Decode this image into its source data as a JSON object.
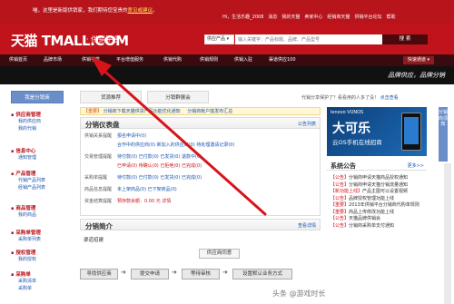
{
  "topbar": {
    "notice_prefix": "喵，这里是新版供销家，我们期待您宝贵的",
    "notice_link": "意见或建议",
    "notice_suffix": "。",
    "links": [
      "Hi，生活乐趣_2008",
      "消息",
      "我的天猫",
      "卖家中心",
      "经销商天猫",
      "供销平台论坛",
      "帮助"
    ]
  },
  "header": {
    "logo": "天猫 TMALL.COM",
    "logo_sub": "· 供销平台",
    "search_type": "供应产品 ▾",
    "search_placeholder": "输入关键字：产品标题、品牌、产品型号",
    "search_button": "搜 索"
  },
  "nav": {
    "items": [
      "供销首页",
      "品牌市场",
      "供销学堂",
      "平台增值服务",
      "供销代购",
      "供销规则",
      "供销入驻",
      "渠道供应100"
    ],
    "user_menu": "快速通道 ▾"
  },
  "slogan": "品牌供应，品牌分销",
  "tabs": {
    "items": [
      "我是分销商",
      "货源推荐",
      "分销群展会"
    ],
    "right_text": "代销分享保护了？看看用的人多了没！",
    "right_link": "点击查看"
  },
  "sidebar": [
    {
      "title": "供应商管理",
      "links": [
        "我的供应商",
        "我的代销"
      ]
    },
    {
      "title": "信息中心",
      "links": [
        "通知管理"
      ]
    },
    {
      "title": "产品管理",
      "links": [
        "代销产品列表",
        "经销产品列表"
      ]
    },
    {
      "title": "商品管理",
      "links": [
        "我的商品"
      ]
    },
    {
      "title": "采购单管理",
      "links": [
        "采购单列表"
      ]
    },
    {
      "title": "授权管理",
      "links": [
        "我的授权"
      ]
    },
    {
      "title": "采购单",
      "links": [
        "采购清单",
        "采购单"
      ]
    }
  ],
  "notice": {
    "tag1": "【重要】",
    "text1": "分销商下载天猫供货产品功能优化通知",
    "text2": "分销商帐户能发布汇总"
  },
  "dashboard": {
    "title": "分销仪表盘",
    "more": "公告列表",
    "rows": [
      {
        "label": "供销关系提醒",
        "text": "报名申请中(0)"
      },
      {
        "label": "",
        "text": "合作中的供应商(0)   新加入的供应商(0)   待处理邀请记录(0)"
      },
      {
        "label": "交易管理提醒",
        "text": "待付款(0)   已付款(0)   已发货(0)   退款中(0)"
      },
      {
        "label": "",
        "text": "已申请(0)   待确认(0)   已拒绝(0)   已完成(0)"
      },
      {
        "label": "采购单提醒",
        "text": "待付款(0)   已付款(0)   已发货(0)   已完成(0)"
      },
      {
        "label": "商品信息提醒",
        "text": "未上架商品(0)   已下架商品(0)"
      },
      {
        "label": "资金结算提醒",
        "text": "预存款余额：0.00 元   详情"
      }
    ]
  },
  "intro": {
    "title": "分销简介",
    "more": "查看详情",
    "tab": "渠道招建",
    "center_button": "供应商同意",
    "steps": [
      "寻找供应商",
      "提交申请",
      "等待审核",
      "设置默认业务方式"
    ]
  },
  "ad": {
    "brands": "lenovo  VUNOS",
    "title": "大可乐",
    "sub": "云OS手机在线招商"
  },
  "news": {
    "title": "系统公告",
    "more": "更多>>",
    "items": [
      {
        "tag": "【公告】",
        "text": "分销商申请天猫商品授权通知"
      },
      {
        "tag": "【公告】",
        "text": "分销商申请天猫分销流量通知"
      },
      {
        "tag": "【新功能上线】",
        "text": "产品主图可以设置视频"
      },
      {
        "tag": "【公告】",
        "text": "品牌授权管理功能上线"
      },
      {
        "tag": "【重要】",
        "text": "2013年供销平台分销商代购单规则"
      },
      {
        "tag": "【重要】",
        "text": "商品上传修改功能上线"
      },
      {
        "tag": "【公告】",
        "text": "天猫品牌供销会"
      },
      {
        "tag": "【公告】",
        "text": "分销商采购单支付通知"
      }
    ]
  },
  "fixbar": "分销商须知",
  "watermark": "头条 @游戏时长"
}
